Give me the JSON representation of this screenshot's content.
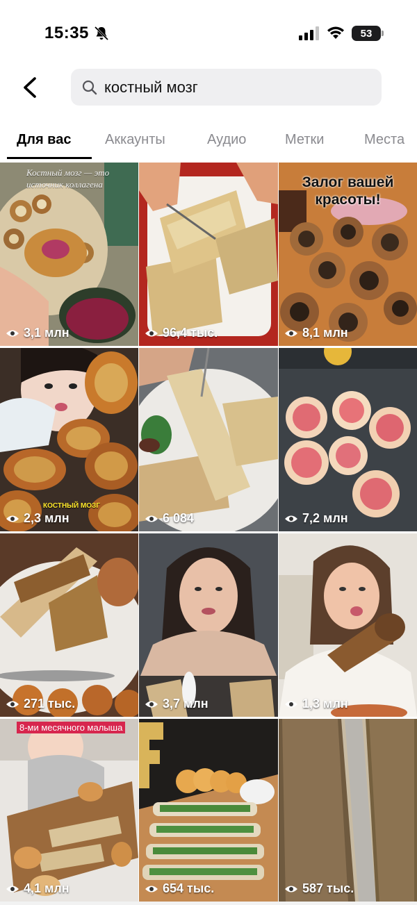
{
  "status_bar": {
    "time": "15:35",
    "battery": "53"
  },
  "search": {
    "query": "костный мозг"
  },
  "tabs": [
    {
      "label": "Для вас",
      "active": true
    },
    {
      "label": "Аккаунты",
      "active": false
    },
    {
      "label": "Аудио",
      "active": false
    },
    {
      "label": "Метки",
      "active": false
    },
    {
      "label": "Места",
      "active": false
    }
  ],
  "results": [
    {
      "views": "3,1 млн",
      "caption": "Костный мозг — это источник коллагена"
    },
    {
      "views": "96,4 тыс."
    },
    {
      "views": "8,1 млн",
      "caption": "Залог вашей красоты!"
    },
    {
      "views": "2,3 млн",
      "caption": "КОСТНЫЙ МОЗГ"
    },
    {
      "views": "6 084"
    },
    {
      "views": "7,2 млн"
    },
    {
      "views": "271 тыс."
    },
    {
      "views": "3,7 млн"
    },
    {
      "views": "1,3 млн"
    },
    {
      "views": "4,1 млн",
      "caption": "8-ми месячного малыша"
    },
    {
      "views": "654 тыс."
    },
    {
      "views": "587 тыс."
    }
  ],
  "colors": {
    "accent": "#000000",
    "muted": "#8a8a8f",
    "search_bg": "#efeff1"
  }
}
